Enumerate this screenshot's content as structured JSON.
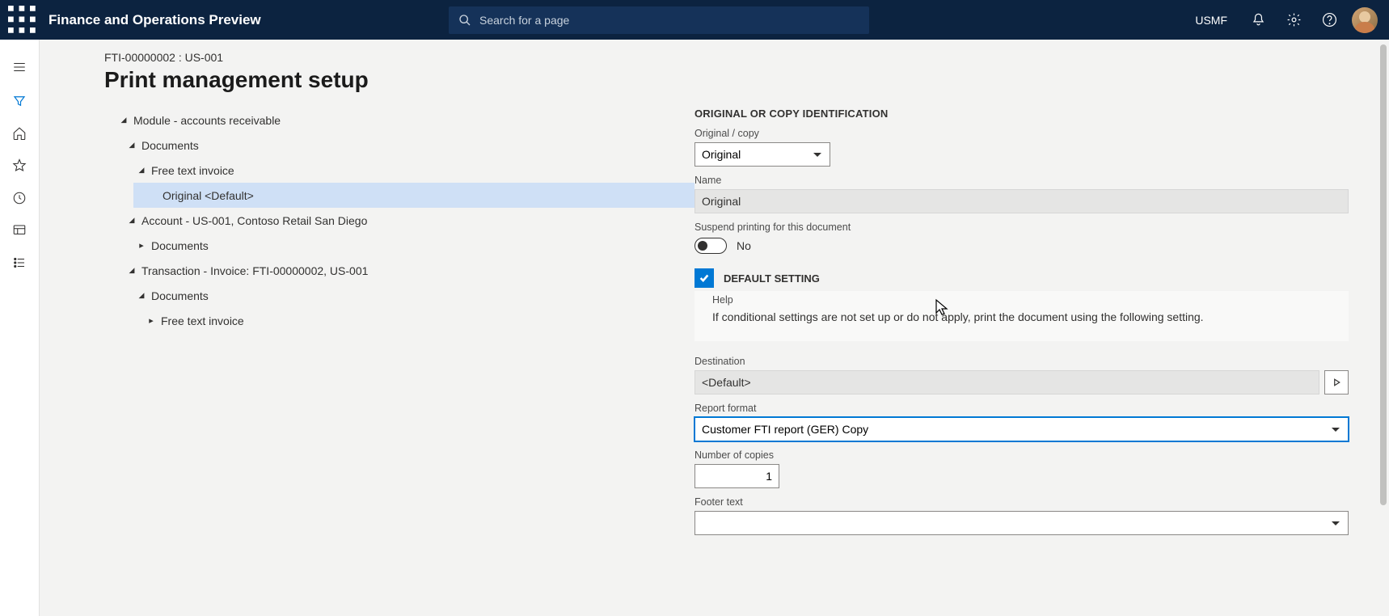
{
  "header": {
    "app_title": "Finance and Operations Preview",
    "search_placeholder": "Search for a page",
    "company": "USMF"
  },
  "breadcrumb": "FTI-00000002 : US-001",
  "page_title": "Print management setup",
  "tree": {
    "n0": "Module - accounts receivable",
    "n1": "Documents",
    "n2": "Free text invoice",
    "n3": "Original <Default>",
    "n4": "Account - US-001, Contoso Retail San Diego",
    "n5": "Documents",
    "n6": "Transaction - Invoice: FTI-00000002, US-001",
    "n7": "Documents",
    "n8": "Free text invoice"
  },
  "form": {
    "section_identification": "ORIGINAL OR COPY IDENTIFICATION",
    "original_copy_label": "Original / copy",
    "original_copy_value": "Original",
    "name_label": "Name",
    "name_value": "Original",
    "suspend_label": "Suspend printing for this document",
    "suspend_value": "No",
    "default_setting_label": "DEFAULT SETTING",
    "help_label": "Help",
    "help_text": "If conditional settings are not set up or do not apply, print the document using the following setting.",
    "destination_label": "Destination",
    "destination_value": "<Default>",
    "report_format_label": "Report format",
    "report_format_value": "Customer FTI report (GER) Copy",
    "copies_label": "Number of copies",
    "copies_value": "1",
    "footer_label": "Footer text",
    "footer_value": ""
  }
}
